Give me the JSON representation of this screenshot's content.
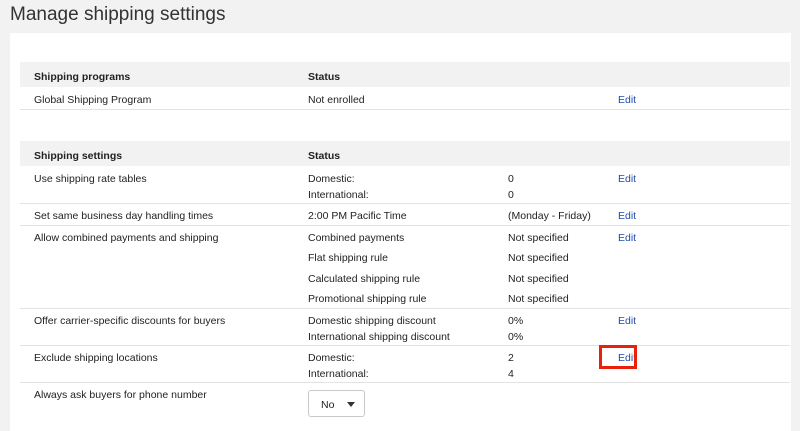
{
  "page": {
    "title": "Manage shipping settings"
  },
  "programs": {
    "header": {
      "name": "Shipping programs",
      "status": "Status"
    },
    "rows": [
      {
        "name": "Global Shipping Program",
        "status": "Not enrolled",
        "action": "Edit"
      }
    ]
  },
  "settings": {
    "header": {
      "name": "Shipping settings",
      "status": "Status"
    },
    "rate_tables": {
      "name": "Use shipping rate tables",
      "lines": [
        {
          "label": "Domestic:",
          "value": "0"
        },
        {
          "label": "International:",
          "value": "0"
        }
      ],
      "action": "Edit"
    },
    "handling": {
      "name": "Set same business day handling times",
      "label": "2:00 PM Pacific Time",
      "value": "(Monday - Friday)",
      "action": "Edit"
    },
    "combined": {
      "name": "Allow combined payments and shipping",
      "lines": [
        {
          "label": "Combined payments",
          "value": "Not specified"
        },
        {
          "label": "Flat shipping rule",
          "value": "Not specified"
        },
        {
          "label": "Calculated shipping rule",
          "value": "Not specified"
        },
        {
          "label": "Promotional shipping rule",
          "value": "Not specified"
        }
      ],
      "action": "Edit"
    },
    "carrier": {
      "name": "Offer carrier-specific discounts for buyers",
      "lines": [
        {
          "label": "Domestic shipping discount",
          "value": "0%"
        },
        {
          "label": "International shipping discount",
          "value": "0%"
        }
      ],
      "action": "Edit"
    },
    "exclude": {
      "name": "Exclude shipping locations",
      "lines": [
        {
          "label": "Domestic:",
          "value": "2"
        },
        {
          "label": "International:",
          "value": "4"
        }
      ],
      "action": "Edit"
    },
    "phone": {
      "name": "Always ask buyers for phone number",
      "select_value": "No"
    }
  },
  "colors": {
    "link": "#1f4ea8",
    "highlight": "#e8200c",
    "header_bg": "#f2f2f2"
  }
}
